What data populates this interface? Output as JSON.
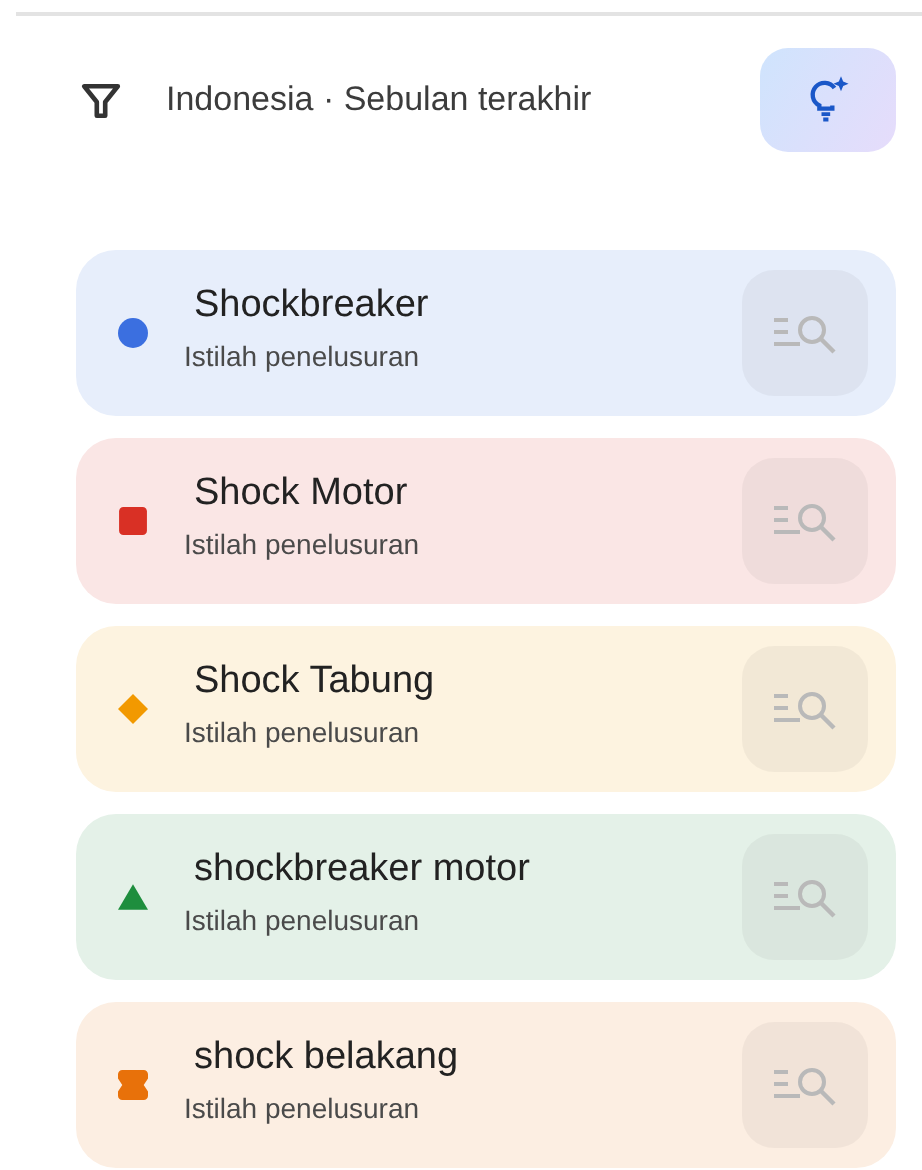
{
  "filter": {
    "label": "Indonesia · Sebulan terakhir"
  },
  "terms": [
    {
      "name": "Shockbreaker",
      "subtitle": "Istilah penelusuran",
      "color": "#3b6fe0",
      "kind": "circle"
    },
    {
      "name": "Shock Motor",
      "subtitle": "Istilah penelusuran",
      "color": "#d93025",
      "kind": "square"
    },
    {
      "name": "Shock Tabung",
      "subtitle": "Istilah penelusuran",
      "color": "#f29900",
      "kind": "diamond"
    },
    {
      "name": "shockbreaker motor",
      "subtitle": "Istilah penelusuran",
      "color": "#1e8e3e",
      "kind": "triangle"
    },
    {
      "name": "shock belakang",
      "subtitle": "Istilah penelusuran",
      "color": "#e8710a",
      "kind": "pill"
    }
  ]
}
